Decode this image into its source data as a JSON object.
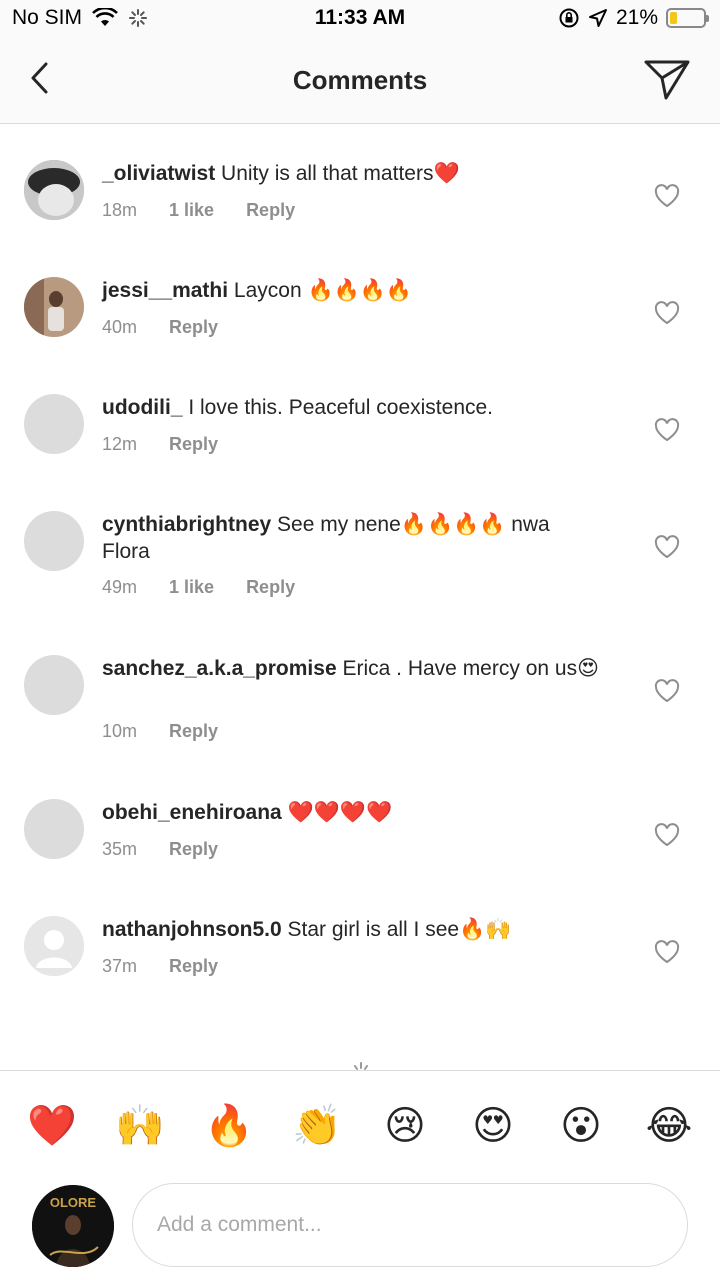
{
  "status": {
    "carrier": "No SIM",
    "time": "11:33 AM",
    "battery_percent": "21%",
    "battery_level": 0.21,
    "battery_color": "#f5c518"
  },
  "header": {
    "title": "Comments",
    "back_icon": "chevron-left-icon",
    "send_icon": "paper-plane-icon"
  },
  "comments": [
    {
      "username": "_oliviatwist",
      "text": "Unity is all that matters❤️",
      "time": "18m",
      "likes": "1 like",
      "reply": "Reply"
    },
    {
      "username": "jessi__mathi",
      "text": "Laycon 🔥🔥🔥🔥",
      "time": "40m",
      "likes": "",
      "reply": "Reply"
    },
    {
      "username": "udodili_",
      "text": "I love this. Peaceful coexistence.",
      "time": "12m",
      "likes": "",
      "reply": "Reply"
    },
    {
      "username": "cynthiabrightney",
      "text": "See my nene🔥🔥🔥🔥 nwa Flora",
      "time": "49m",
      "likes": "1 like",
      "reply": "Reply"
    },
    {
      "username": "sanchez_a.k.a_promise",
      "text": "Erica . Have mercy on us😍",
      "time": "10m",
      "likes": "",
      "reply": "Reply"
    },
    {
      "username": "obehi_enehiroana",
      "text": "❤️❤️❤️❤️",
      "time": "35m",
      "likes": "",
      "reply": "Reply"
    },
    {
      "username": "nathanjohnson5.0",
      "text": "Star girl is all I see🔥🙌",
      "time": "37m",
      "likes": "",
      "reply": "Reply"
    }
  ],
  "quick_reactions": [
    "❤️",
    "🙌",
    "🔥",
    "👏",
    "😢",
    "😍",
    "😮",
    "😂"
  ],
  "composer": {
    "placeholder": "Add a comment...",
    "avatar_text": "OLORE"
  }
}
